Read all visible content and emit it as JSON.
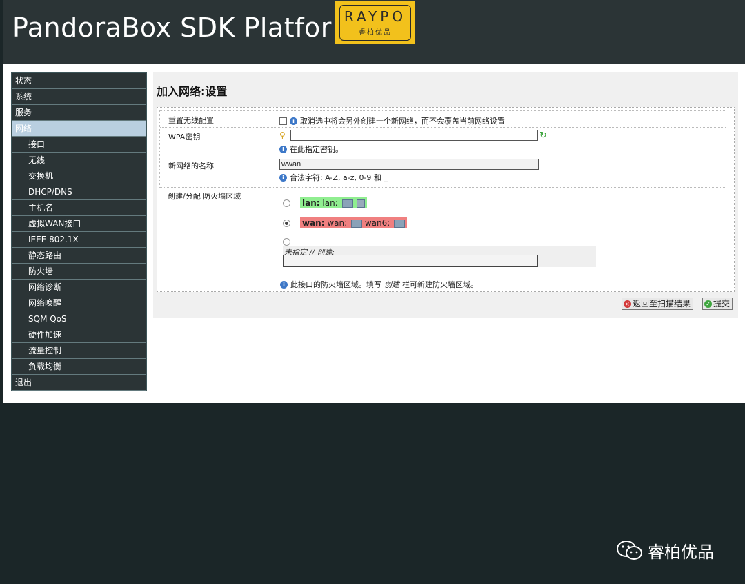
{
  "header": {
    "title": "PandoraBox SDK Platfor",
    "logo": {
      "brand": "RAYPO",
      "sub": "睿柏优品"
    }
  },
  "sidebar": {
    "items": [
      {
        "label": "状态",
        "sub": false
      },
      {
        "label": "系统",
        "sub": false
      },
      {
        "label": "服务",
        "sub": false
      },
      {
        "label": "网络",
        "sub": false,
        "active": true
      },
      {
        "label": "接口",
        "sub": true
      },
      {
        "label": "无线",
        "sub": true
      },
      {
        "label": "交换机",
        "sub": true
      },
      {
        "label": "DHCP/DNS",
        "sub": true
      },
      {
        "label": "主机名",
        "sub": true
      },
      {
        "label": "虚拟WAN接口",
        "sub": true
      },
      {
        "label": "IEEE 802.1X",
        "sub": true
      },
      {
        "label": "静态路由",
        "sub": true
      },
      {
        "label": "防火墙",
        "sub": true
      },
      {
        "label": "网络诊断",
        "sub": true
      },
      {
        "label": "网络唤醒",
        "sub": true
      },
      {
        "label": "SQM QoS",
        "sub": true
      },
      {
        "label": "硬件加速",
        "sub": true
      },
      {
        "label": "流量控制",
        "sub": true
      },
      {
        "label": "负载均衡",
        "sub": true
      },
      {
        "label": "退出",
        "sub": false
      }
    ]
  },
  "main": {
    "heading": "加入网络:设置",
    "reset": {
      "label": "重置无线配置",
      "help": "取消选中将会另外创建一个新网络，而不会覆盖当前网络设置",
      "checked": false
    },
    "wpa": {
      "label": "WPA密钥",
      "value": "",
      "help": "在此指定密钥。"
    },
    "netname": {
      "label": "新网络的名称",
      "value": "wwan",
      "help": "合法字符: A-Z, a-z, 0-9 和 _"
    },
    "firewall": {
      "label": "创建/分配 防火墙区域",
      "zones": [
        {
          "name": "lan:",
          "members": "lan:",
          "checked": false
        },
        {
          "name": "wan:",
          "members": "wan:",
          "members2": "wan6:",
          "checked": true
        }
      ],
      "unspecified_label": "未指定 // 创建:",
      "unspecified_value": "",
      "help": "此接口的防火墙区域。填写",
      "help_em": "创建",
      "help_tail": "栏可新建防火墙区域。"
    },
    "buttons": {
      "back": "返回至扫描结果",
      "submit": "提交"
    }
  },
  "watermark": {
    "text": "睿柏优品"
  },
  "colors": {
    "header_bg": "#2b3436",
    "sidebar_active": "#b9cfe0",
    "lan_zone": "#90ee90",
    "wan_zone": "#f08080",
    "logo_bg": "#f2c11c"
  }
}
